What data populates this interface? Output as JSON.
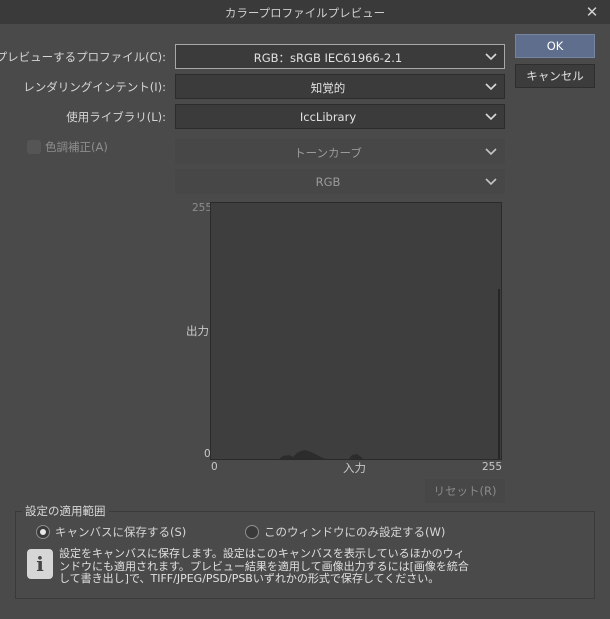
{
  "window": {
    "title": "カラープロファイルプレビュー",
    "close_glyph": "✕"
  },
  "fields": {
    "preview_profile": {
      "label": "プレビューするプロファイル(C):",
      "value": "RGB：sRGB IEC61966-2.1"
    },
    "rendering_intent": {
      "label": "レンダリングインテント(I):",
      "value": "知覚的"
    },
    "library": {
      "label": "使用ライブラリ(L):",
      "value": "IccLibrary"
    }
  },
  "color_correction": {
    "checkbox_label": "色調補正(A)",
    "checked": false,
    "curve_type": "トーンカーブ",
    "channel": "RGB"
  },
  "graph": {
    "y_label": "出力",
    "x_label": "入力",
    "y_max": "255",
    "y_min": "0",
    "x_min": "0",
    "x_max": "255"
  },
  "buttons": {
    "ok": "OK",
    "cancel": "キャンセル",
    "reset": "リセット(R)"
  },
  "apply_scope": {
    "title": "設定の適用範囲",
    "options": [
      {
        "label": "キャンバスに保存する(S)",
        "selected": true
      },
      {
        "label": "このウィンドウにのみ設定する(W)",
        "selected": false
      }
    ]
  },
  "info": {
    "icon": "info-icon",
    "lines": [
      "設定をキャンバスに保存します。設定はこのキャンバスを表示しているほかのウィ",
      "ンドウにも適用されます。プレビュー結果を適用して画像出力するには[画像を統合",
      "して書き出し]で、TIFF/JPEG/PSD/PSBいずれかの形式で保存してください。"
    ]
  },
  "colors": {
    "background": "#4a4a4a",
    "titlebar": "#3a3a3a",
    "field": "#3b3b3b",
    "accent": "#5e6e8c"
  }
}
